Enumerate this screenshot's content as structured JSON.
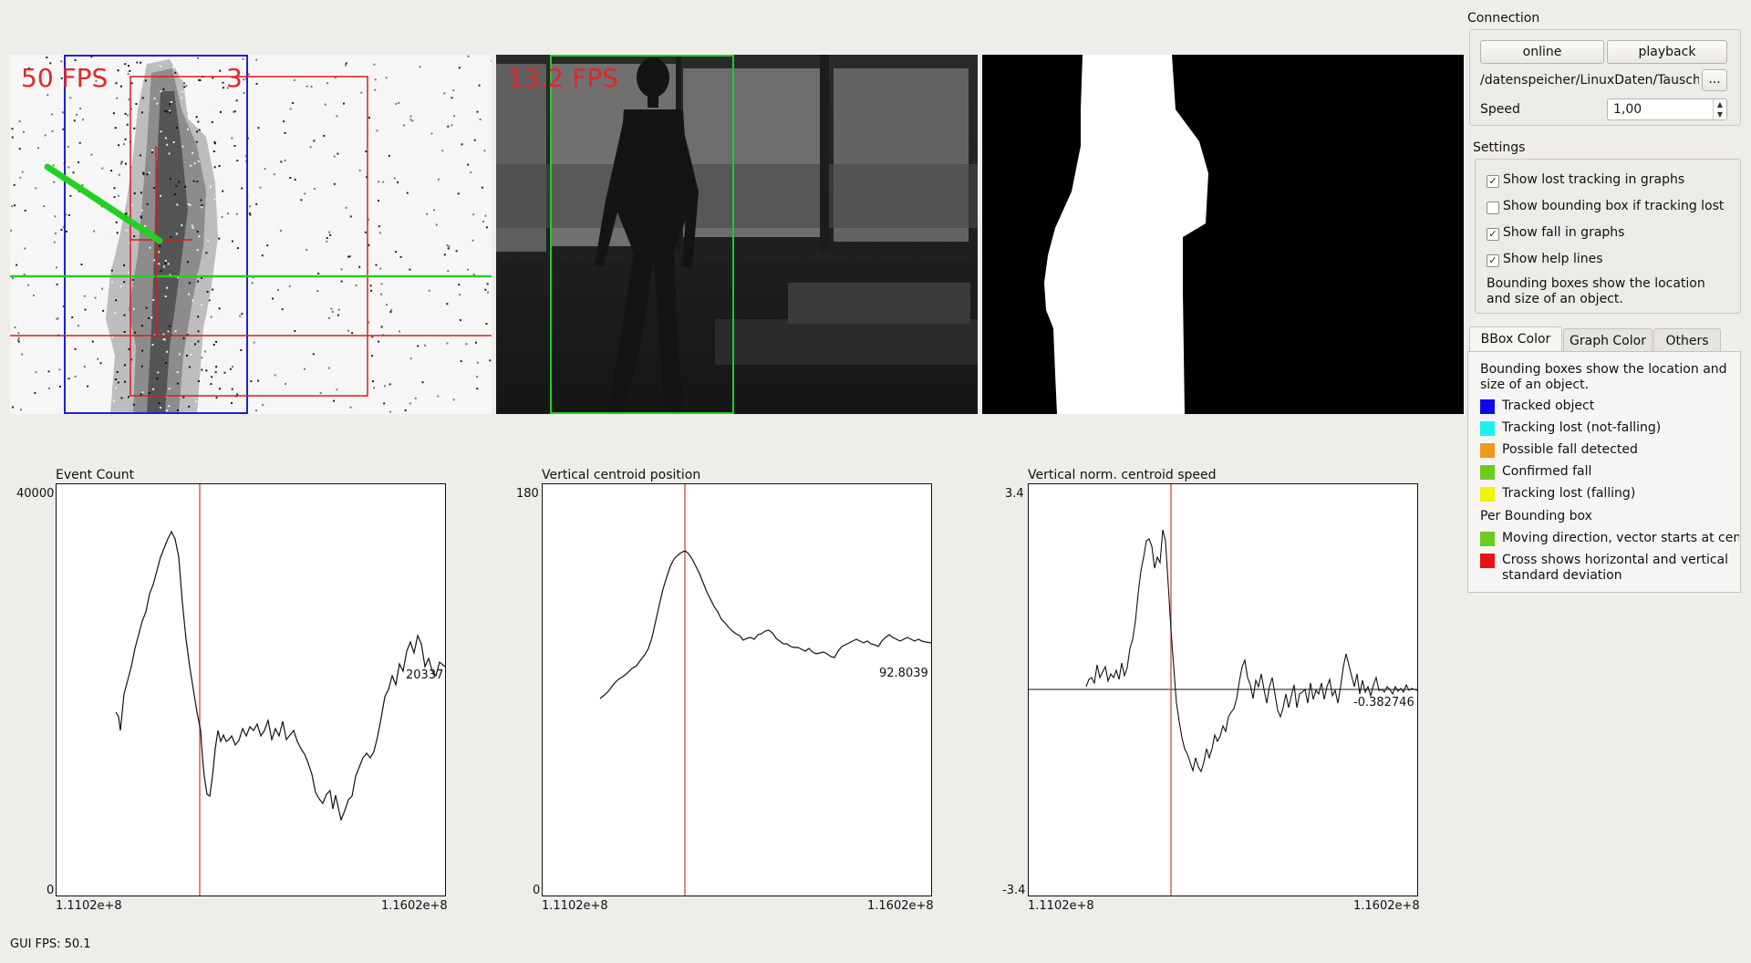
{
  "views": {
    "events": {
      "fps": "50 FPS",
      "count": "3"
    },
    "camera": {
      "fps": "13.2 FPS"
    }
  },
  "graphs": [
    {
      "title": "Event Count",
      "ymax": "40000",
      "ymin": "0",
      "xmin": "1.1102e+8",
      "xmax": "1.1602e+8",
      "last_value": "20337"
    },
    {
      "title": "Vertical centroid position",
      "ymax": "180",
      "ymin": "0",
      "xmin": "1.1102e+8",
      "xmax": "1.1602e+8",
      "last_value": "92.8039"
    },
    {
      "title": "Vertical norm. centroid speed",
      "ymax": "3.4",
      "ymin": "-3.4",
      "xmin": "1.1102e+8",
      "xmax": "1.1602e+8",
      "last_value": "-0.382746"
    }
  ],
  "connection": {
    "title": "Connection",
    "online_label": "online",
    "playback_label": "playback",
    "path": "/datenspeicher/LinuxDaten/Tausch",
    "browse_label": "...",
    "speed_label": "Speed",
    "speed_value": "1,00"
  },
  "settings": {
    "title": "Settings",
    "checks": [
      {
        "label": "Show lost tracking in graphs",
        "checked": true
      },
      {
        "label": "Show bounding box if tracking lost",
        "checked": false
      },
      {
        "label": "Show fall in graphs",
        "checked": true
      },
      {
        "label": "Show help lines",
        "checked": true
      }
    ],
    "help_text": "Bounding boxes show the location and size of an object."
  },
  "tabs": [
    {
      "label": "BBox Color",
      "active": true
    },
    {
      "label": "Graph Color",
      "active": false
    },
    {
      "label": "Others",
      "active": false
    }
  ],
  "bbox_pane": {
    "intro": "Bounding boxes show the location and size of an object.",
    "colors": [
      {
        "label": "Tracked object",
        "color": "#0a0af0"
      },
      {
        "label": "Tracking lost (not-falling)",
        "color": "#1ef0f0"
      },
      {
        "label": "Possible fall detected",
        "color": "#f09a1a"
      },
      {
        "label": "Confirmed fall",
        "color": "#6ccc1e"
      },
      {
        "label": "Tracking lost (falling)",
        "color": "#f2f20a"
      }
    ],
    "per_box_title": "Per Bounding box",
    "per_box": [
      {
        "label": "Moving direction, vector starts at cen",
        "color": "#6ccc1e"
      },
      {
        "label": "Cross shows horizontal and vertical standard deviation",
        "color": "#e8101a"
      }
    ]
  },
  "status": {
    "gui_fps": "GUI FPS: 50.1"
  }
}
